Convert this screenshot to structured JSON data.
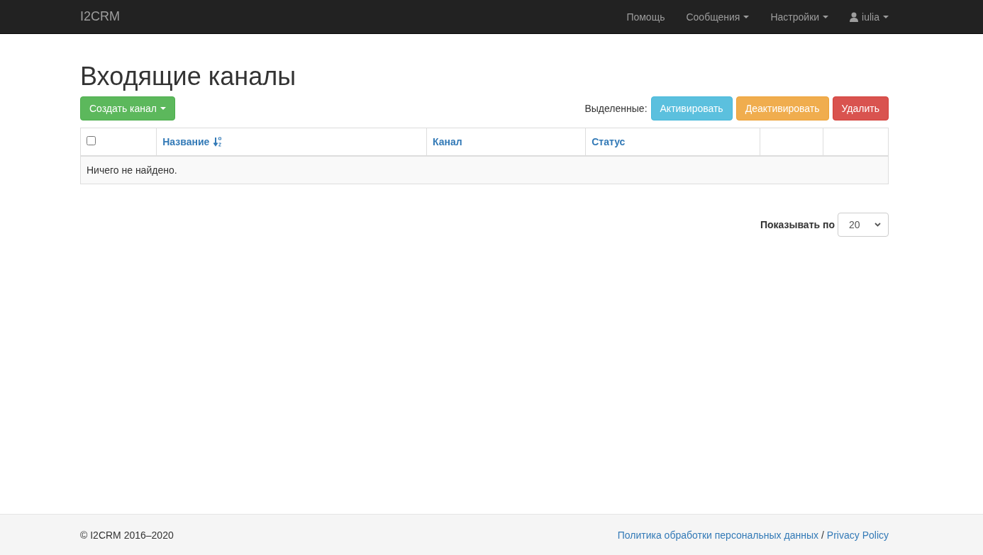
{
  "navbar": {
    "brand": "I2CRM",
    "items": [
      {
        "label": "Помощь",
        "dropdown": false,
        "user": false
      },
      {
        "label": "Сообщения",
        "dropdown": true,
        "user": false
      },
      {
        "label": "Настройки",
        "dropdown": true,
        "user": false
      },
      {
        "label": "iulia",
        "dropdown": true,
        "user": true
      }
    ]
  },
  "page": {
    "title": "Входящие каналы",
    "create_button": "Создать канал",
    "bulk_label": "Выделенные:",
    "bulk_buttons": [
      {
        "label": "Активировать",
        "kind": "info"
      },
      {
        "label": "Деактивировать",
        "kind": "warning"
      },
      {
        "label": "Удалить",
        "kind": "danger"
      }
    ]
  },
  "table": {
    "select_all": {
      "checked": false
    },
    "columns": [
      {
        "label": "Название",
        "sorted": true
      },
      {
        "label": "Канал",
        "sorted": false
      },
      {
        "label": "Статус",
        "sorted": false
      },
      {
        "sorted": false
      },
      {
        "sorted": false
      }
    ],
    "empty_message": "Ничего не найдено."
  },
  "page_size": {
    "label": "Показывать по",
    "value": "20"
  },
  "footer": {
    "copyright": "© I2CRM 2016–2020",
    "link": "Политика обработки персональных данных",
    "separator": "/",
    "link2": "Privacy Policy"
  }
}
